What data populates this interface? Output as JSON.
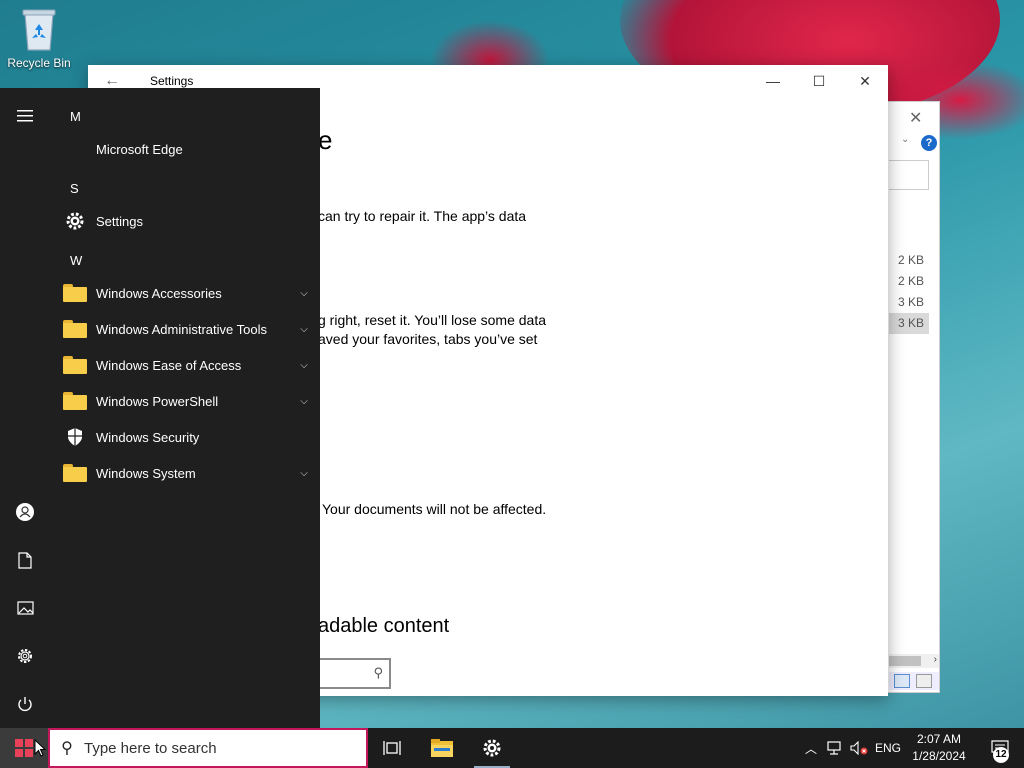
{
  "desktop": {
    "icons": [
      {
        "label": "Recycle Bin",
        "icon": "recycle-bin-icon"
      }
    ]
  },
  "explorer": {
    "sizes": [
      "2 KB",
      "2 KB",
      "3 KB",
      "3 KB"
    ],
    "help_label": "?"
  },
  "settings": {
    "title": "Settings",
    "heading_fragment": "e",
    "repair_text": "can try to repair it. The app’s data",
    "reset_text_1": "g right, reset it. You’ll lose some data",
    "reset_text_2": "aved your favorites, tabs you’ve set",
    "documents_text": "Your documents will not be affected.",
    "downloadable_heading": "adable content"
  },
  "start_menu": {
    "sections": [
      {
        "letter": "M",
        "apps": [
          {
            "label": "Microsoft Edge",
            "icon": "none",
            "expandable": false
          }
        ]
      },
      {
        "letter": "S",
        "apps": [
          {
            "label": "Settings",
            "icon": "gear-icon",
            "expandable": false
          }
        ]
      },
      {
        "letter": "W",
        "apps": [
          {
            "label": "Windows Accessories",
            "icon": "folder-icon",
            "expandable": true
          },
          {
            "label": "Windows Administrative Tools",
            "icon": "folder-icon",
            "expandable": true
          },
          {
            "label": "Windows Ease of Access",
            "icon": "folder-icon",
            "expandable": true
          },
          {
            "label": "Windows PowerShell",
            "icon": "folder-icon",
            "expandable": true
          },
          {
            "label": "Windows Security",
            "icon": "shield-icon",
            "expandable": false
          },
          {
            "label": "Windows System",
            "icon": "folder-icon",
            "expandable": true
          }
        ]
      }
    ],
    "rail": [
      "hamburger-menu-icon",
      "user-icon",
      "documents-icon",
      "pictures-icon",
      "gear-icon",
      "power-icon"
    ]
  },
  "taskbar": {
    "search_placeholder": "Type here to search",
    "language": "ENG",
    "time": "2:07 AM",
    "date": "1/28/2024",
    "notification_count": "12",
    "pinned": [
      "task-view-icon",
      "file-explorer-icon",
      "settings-gear-icon"
    ]
  },
  "colors": {
    "start_bg": "#1f1f1f",
    "taskbar_bg": "#1c1c1c",
    "search_border": "#c2185b",
    "folder_yellow": "#f8cd4a"
  }
}
